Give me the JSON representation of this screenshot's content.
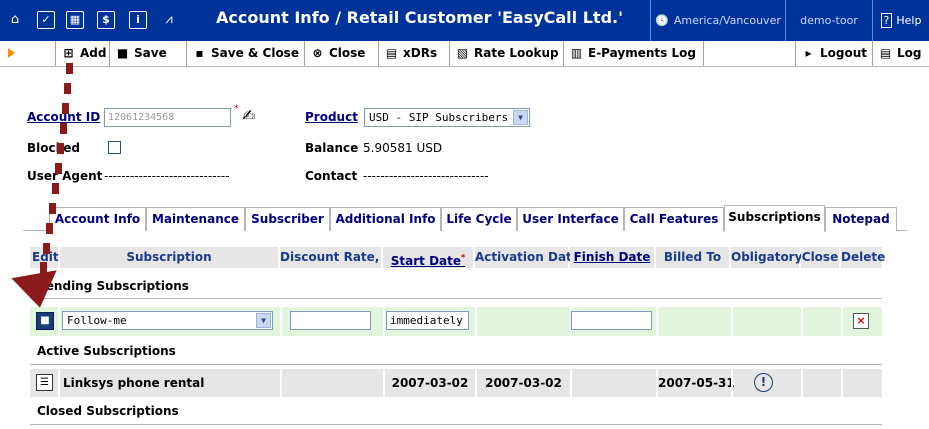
{
  "header": {
    "title": "Account Info / Retail Customer 'EasyCall Ltd.'",
    "timezone": "America/Vancouver",
    "user": "demo-toor",
    "help": "Help"
  },
  "toolbar": {
    "add": "Add",
    "save": "Save",
    "save_close": "Save & Close",
    "close": "Close",
    "xdrs": "xDRs",
    "rate_lookup": "Rate Lookup",
    "epayments": "E-Payments Log",
    "logout": "Logout",
    "log": "Log"
  },
  "form": {
    "account_id_label": "Account ID",
    "account_id_value": "12061234568",
    "required_mark": "*",
    "product_label": "Product",
    "product_value": "USD - SIP Subscribers",
    "blocked_label": "Blocked",
    "balance_label": "Balance",
    "balance_value": "5.90581 USD",
    "user_agent_label": "User Agent",
    "user_agent_value": "-----------------------------",
    "contact_label": "Contact",
    "contact_value": "-----------------------------"
  },
  "tabs": [
    {
      "label": "Account Info"
    },
    {
      "label": "Maintenance"
    },
    {
      "label": "Subscriber"
    },
    {
      "label": "Additional Info"
    },
    {
      "label": "Life Cycle"
    },
    {
      "label": "User Interface"
    },
    {
      "label": "Call Features"
    },
    {
      "label": "Subscriptions"
    },
    {
      "label": "Notepad"
    }
  ],
  "table": {
    "headers": {
      "edit": "Edit",
      "subscription": "Subscription",
      "discount": "Discount Rate, %",
      "start_date": "Start Date",
      "activation_date": "Activation Date",
      "finish_date": "Finish Date",
      "billed_to": "Billed To",
      "obligatory": "Obligatory",
      "close": "Close",
      "delete": "Delete"
    },
    "pending_label": "Pending Subscriptions",
    "pending_row": {
      "subscription": "Follow-me",
      "discount": "",
      "start_date": "immediately",
      "finish_date": ""
    },
    "active_label": "Active Subscriptions",
    "active_row": {
      "subscription": "Linksys phone rental",
      "start_date": "2007-03-02",
      "activation_date": "2007-03-02",
      "billed_to": "2007-05-31"
    },
    "closed_label": "Closed Subscriptions"
  },
  "colors": {
    "header_bg": "#003399",
    "pending_row_bg": "#e1f5dc",
    "active_row_bg": "#e6e6e6",
    "annotation": "#8b1a1a"
  }
}
